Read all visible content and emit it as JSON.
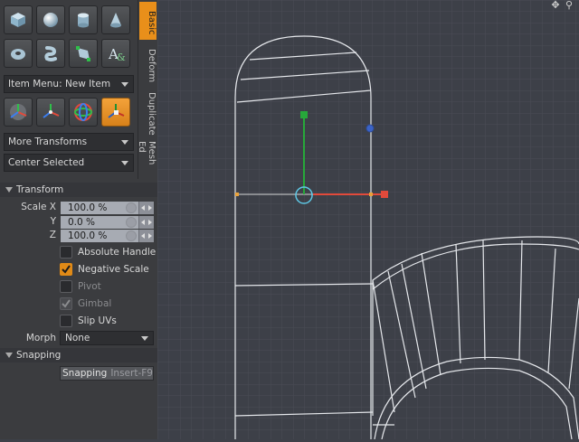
{
  "side_tabs": [
    "Basic",
    "Deform",
    "Duplicate",
    "Mesh Ed"
  ],
  "tool_buttons": {
    "row1": [
      "cube-icon",
      "sphere-icon",
      "cylinder-icon",
      "cone-icon"
    ],
    "row2": [
      "torus-icon",
      "capsule-icon",
      "pen-tool-icon",
      "text-tool-icon"
    ],
    "row3": [
      "move-tool-icon",
      "rotate-tool-icon",
      "scale-tool-icon",
      "transform-tool-icon"
    ]
  },
  "item_menu": {
    "value": "Item Menu: New Item"
  },
  "more_transforms": {
    "value": "More Transforms"
  },
  "center_selected": {
    "value": "Center Selected"
  },
  "transform_section": {
    "title": "Transform",
    "scale_label": "Scale X",
    "y_label": "Y",
    "z_label": "Z",
    "scale_x": "100.0 %",
    "scale_y": "0.0 %",
    "scale_z": "100.0 %"
  },
  "options": {
    "absolute_handle": {
      "label": "Absolute Handle",
      "checked": false
    },
    "negative_scale": {
      "label": "Negative Scale",
      "checked": true
    },
    "pivot": {
      "label": "Pivot",
      "checked": false,
      "disabled": true
    },
    "gimbal": {
      "label": "Gimbal",
      "checked": true,
      "disabled": true
    },
    "slip_uvs": {
      "label": "Slip UVs",
      "checked": false
    }
  },
  "morph": {
    "label": "Morph",
    "value": "None"
  },
  "snapping_section": {
    "title": "Snapping",
    "button_label": "Snapping",
    "shortcut": "Insert-F9"
  },
  "colors": {
    "accent": "#e98f1a",
    "viewport_bg": "#3d4048",
    "grid": "#4a4d56",
    "axis_x": "#e24a3b",
    "axis_y": "#27a83a",
    "handle_ring": "#5ec8e6"
  }
}
